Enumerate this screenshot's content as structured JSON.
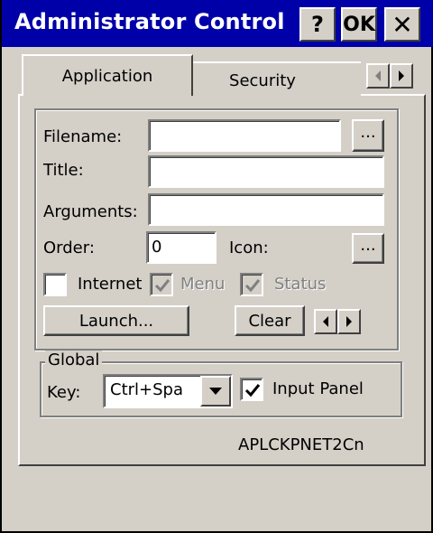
{
  "window": {
    "title": "Administrator Control",
    "help_label": "?",
    "ok_label": "OK",
    "close_label": "✕"
  },
  "tabs": [
    {
      "label": "Application",
      "selected": true
    },
    {
      "label": "Security",
      "selected": false
    }
  ],
  "application": {
    "filename_label": "Filename:",
    "filename_value": "",
    "filename_browse_label": "...",
    "title_label": "Title:",
    "title_value": "",
    "arguments_label": "Arguments:",
    "arguments_value": "",
    "order_label": "Order:",
    "order_value": "0",
    "icon_label": "Icon:",
    "icon_browse_label": "...",
    "internet_label": "Internet",
    "internet_checked": false,
    "menu_label": "Menu",
    "menu_checked": true,
    "status_label": "Status",
    "status_checked": true,
    "launch_label": "Launch...",
    "clear_label": "Clear"
  },
  "global": {
    "legend": "Global",
    "key_label": "Key:",
    "key_value": "Ctrl+Spa",
    "input_panel_label": "Input Panel",
    "input_panel_checked": true
  },
  "footer": {
    "id_text": "APLCKPNET2Cn"
  },
  "colors": {
    "titlebar": "#0000a8",
    "face": "#d4d0c8"
  }
}
